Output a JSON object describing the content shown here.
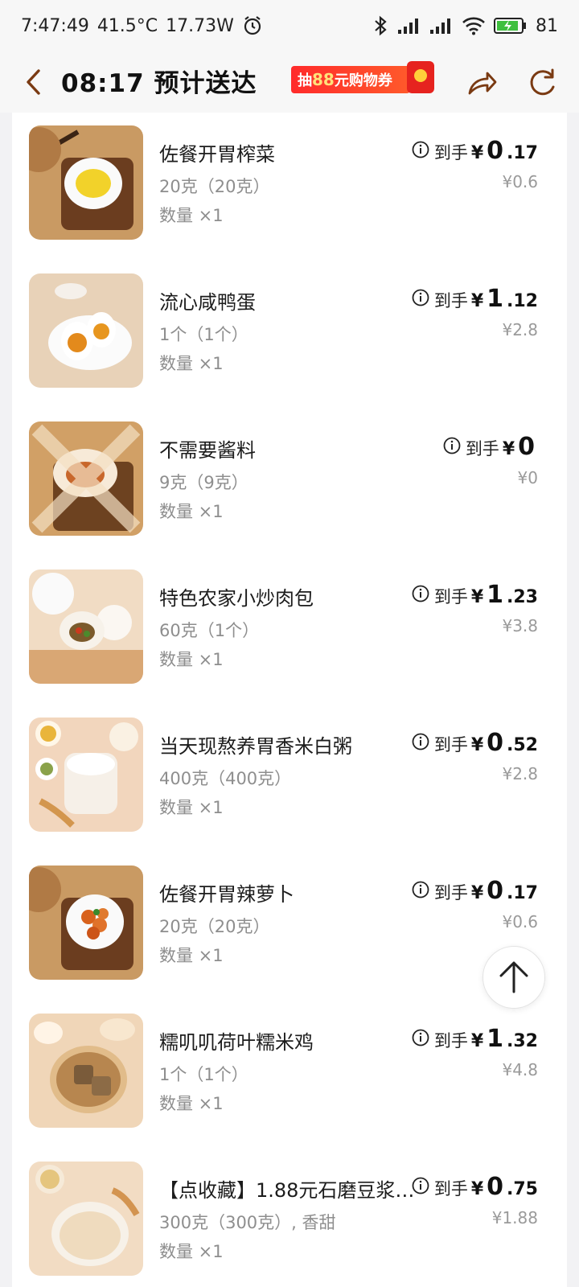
{
  "status_bar": {
    "time": "7:47:49",
    "temperature": "41.5°C",
    "power": "17.73W",
    "battery": "81",
    "icons": [
      "alarm-icon",
      "bluetooth-icon",
      "signal-icon",
      "signal-icon",
      "wifi-icon",
      "battery-icon"
    ]
  },
  "header": {
    "title": "08:17 预计送达",
    "coupon_prefix": "抽",
    "coupon_amount": "88",
    "coupon_suffix": "元购物券",
    "icons": [
      "back-icon",
      "share-icon",
      "refresh-icon"
    ]
  },
  "items": [
    {
      "name": "佐餐开胃榨菜",
      "spec": "20克（20克）",
      "qty": "数量 ×1",
      "label": "到手",
      "yen": "¥",
      "price_int": "0",
      "price_dec": ".17",
      "orig": "¥0.6",
      "thumb": "pickled-mustard"
    },
    {
      "name": "流心咸鸭蛋",
      "spec": "1个（1个）",
      "qty": "数量 ×1",
      "label": "到手",
      "yen": "¥",
      "price_int": "1",
      "price_dec": ".12",
      "orig": "¥2.8",
      "thumb": "salted-egg"
    },
    {
      "name": "不需要酱料",
      "spec": "9克（9克）",
      "qty": "数量 ×1",
      "label": "到手",
      "yen": "¥",
      "price_int": "0",
      "price_dec": "",
      "orig": "¥0",
      "thumb": "sauce"
    },
    {
      "name": "特色农家小炒肉包",
      "spec": "60克（1个）",
      "qty": "数量 ×1",
      "label": "到手",
      "yen": "¥",
      "price_int": "1",
      "price_dec": ".23",
      "orig": "¥3.8",
      "thumb": "bun"
    },
    {
      "name": "当天现熬养胃香米白粥",
      "spec": "400克（400克）",
      "qty": "数量 ×1",
      "label": "到手",
      "yen": "¥",
      "price_int": "0",
      "price_dec": ".52",
      "orig": "¥2.8",
      "thumb": "porridge"
    },
    {
      "name": "佐餐开胃辣萝卜",
      "spec": "20克（20克）",
      "qty": "数量 ×1",
      "label": "到手",
      "yen": "¥",
      "price_int": "0",
      "price_dec": ".17",
      "orig": "¥0.6",
      "thumb": "radish"
    },
    {
      "name": "糯叽叽荷叶糯米鸡",
      "spec": "1个（1个）",
      "qty": "数量 ×1",
      "label": "到手",
      "yen": "¥",
      "price_int": "1",
      "price_dec": ".32",
      "orig": "¥4.8",
      "thumb": "rice-chicken"
    },
    {
      "name": "【点收藏】1.88元石磨豆浆…",
      "spec": "300克（300克）, 香甜",
      "qty": "数量 ×1",
      "label": "到手",
      "yen": "¥",
      "price_int": "0",
      "price_dec": ".75",
      "orig": "¥1.88",
      "thumb": "soy-milk"
    }
  ],
  "colors": {
    "accent_red": "#e6231f",
    "header_icon_brown": "#7a3a12"
  }
}
